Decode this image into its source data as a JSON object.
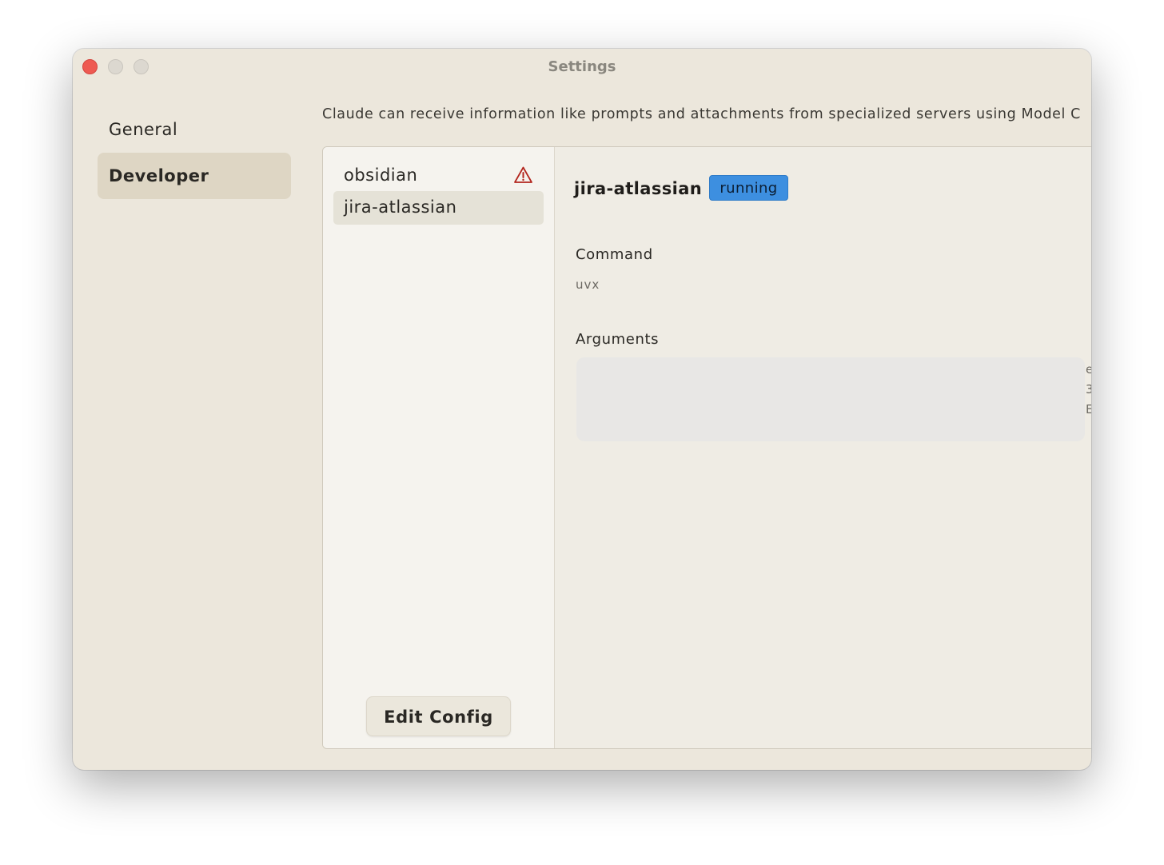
{
  "window": {
    "title": "Settings"
  },
  "nav": {
    "items": [
      {
        "label": "General"
      },
      {
        "label": "Developer"
      }
    ]
  },
  "description": "Claude can receive information like prompts and attachments from specialized servers using Model C",
  "servers": [
    {
      "name": "obsidian",
      "status_icon": "warning-icon"
    },
    {
      "name": "jira-atlassian"
    }
  ],
  "edit_config_label": "Edit Config",
  "detail": {
    "title": "jira-atlassian",
    "status": "running",
    "status_color": "#3d8fe0",
    "command_label": "Command",
    "command_value": "uvx",
    "arguments_label": "Arguments",
    "arguments_edge": [
      "e",
      "3",
      "E"
    ]
  },
  "colors": {
    "close_button": "#ee5a52",
    "window_background": "#ece7dc",
    "warning": "#b3261e"
  }
}
